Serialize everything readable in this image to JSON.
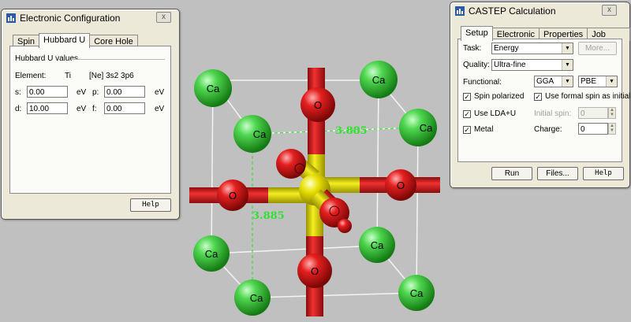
{
  "scene": {
    "atoms": {
      "calcium": "Ca",
      "oxygen": "O"
    },
    "measurements": [
      "3.885",
      "3.885"
    ],
    "colors": {
      "calcium": "#37c037",
      "oxygen": "#e01818",
      "titanium": "#e6e000",
      "distance_label": "#32e032",
      "background": "#c0c0c0"
    }
  },
  "electronic_configuration": {
    "title": "Electronic Configuration",
    "close_label": "x",
    "tabs": [
      "Spin",
      "Hubbard U",
      "Core Hole"
    ],
    "active_tab": "Hubbard U",
    "group_label": "Hubbard U values",
    "element_label": "Element:",
    "element_value": "Ti",
    "configuration": "[Ne] 3s2 3p6",
    "fields": {
      "s": {
        "label": "s:",
        "value": "0.00",
        "unit": "eV"
      },
      "p": {
        "label": "p:",
        "value": "0.00",
        "unit": "eV"
      },
      "d": {
        "label": "d:",
        "value": "10.00",
        "unit": "eV"
      },
      "f": {
        "label": "f:",
        "value": "0.00",
        "unit": "eV"
      }
    },
    "help_label": "Help"
  },
  "castep": {
    "title": "CASTEP Calculation",
    "close_label": "x",
    "tabs": [
      "Setup",
      "Electronic",
      "Properties",
      "Job Control"
    ],
    "active_tab": "Setup",
    "task_label": "Task:",
    "task_value": "Energy",
    "more_label": "More...",
    "quality_label": "Quality:",
    "quality_value": "Ultra-fine",
    "functional_label": "Functional:",
    "functional_type": "GGA",
    "functional_value": "PBE",
    "spin_polarized_label": "Spin polarized",
    "spin_polarized": true,
    "formal_spin_label": "Use formal spin as initial",
    "formal_spin": true,
    "lda_u_label": "Use LDA+U",
    "lda_u": true,
    "initial_spin_label": "Initial spin:",
    "initial_spin_value": "0",
    "metal_label": "Metal",
    "metal": true,
    "charge_label": "Charge:",
    "charge_value": "0",
    "run_label": "Run",
    "files_label": "Files...",
    "help_label": "Help"
  }
}
